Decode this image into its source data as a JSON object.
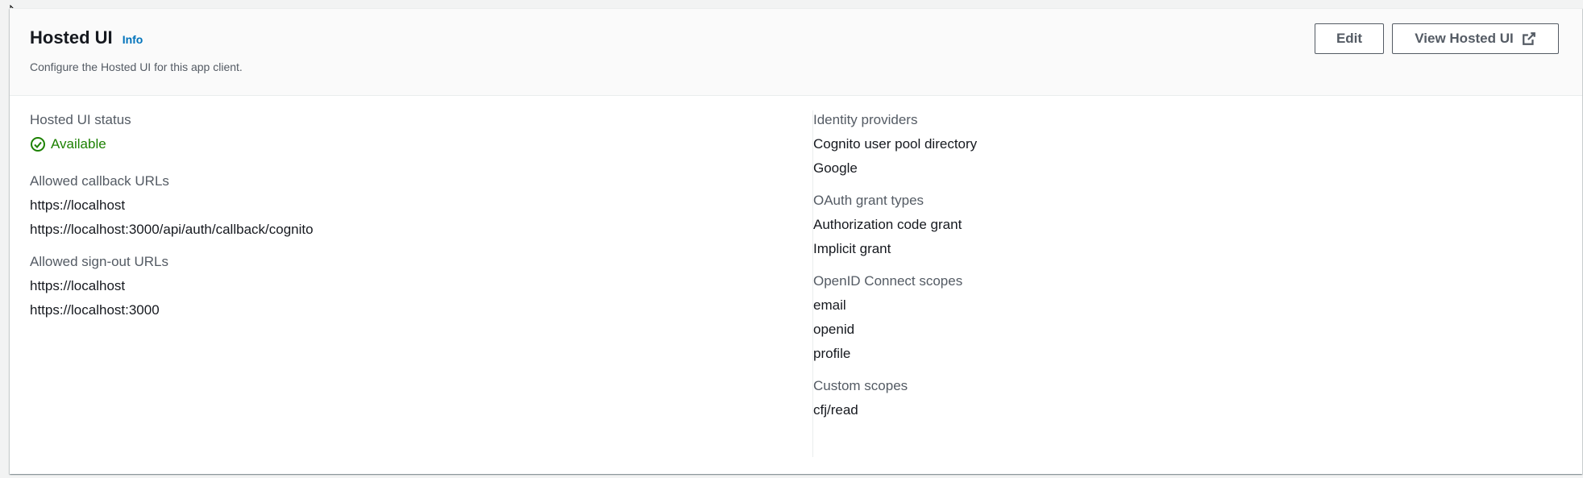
{
  "header": {
    "title": "Hosted UI",
    "info_label": "Info",
    "description": "Configure the Hosted UI for this app client.",
    "edit_label": "Edit",
    "view_label": "View Hosted UI"
  },
  "left": {
    "status": {
      "label": "Hosted UI status",
      "value": "Available",
      "color": "#1d8102"
    },
    "callback": {
      "label": "Allowed callback URLs",
      "values": [
        "https://localhost",
        "https://localhost:3000/api/auth/callback/cognito"
      ]
    },
    "signout": {
      "label": "Allowed sign-out URLs",
      "values": [
        "https://localhost",
        "https://localhost:3000"
      ]
    }
  },
  "right": {
    "idp": {
      "label": "Identity providers",
      "values": [
        "Cognito user pool directory",
        "Google"
      ]
    },
    "grants": {
      "label": "OAuth grant types",
      "values": [
        "Authorization code grant",
        "Implicit grant"
      ]
    },
    "oidc": {
      "label": "OpenID Connect scopes",
      "values": [
        "email",
        "openid",
        "profile"
      ]
    },
    "custom": {
      "label": "Custom scopes",
      "values": [
        "cfj/read"
      ]
    }
  },
  "icons": {
    "status": "check-circle-icon",
    "external": "external-link-icon",
    "cursor": "mouse-cursor-icon"
  }
}
